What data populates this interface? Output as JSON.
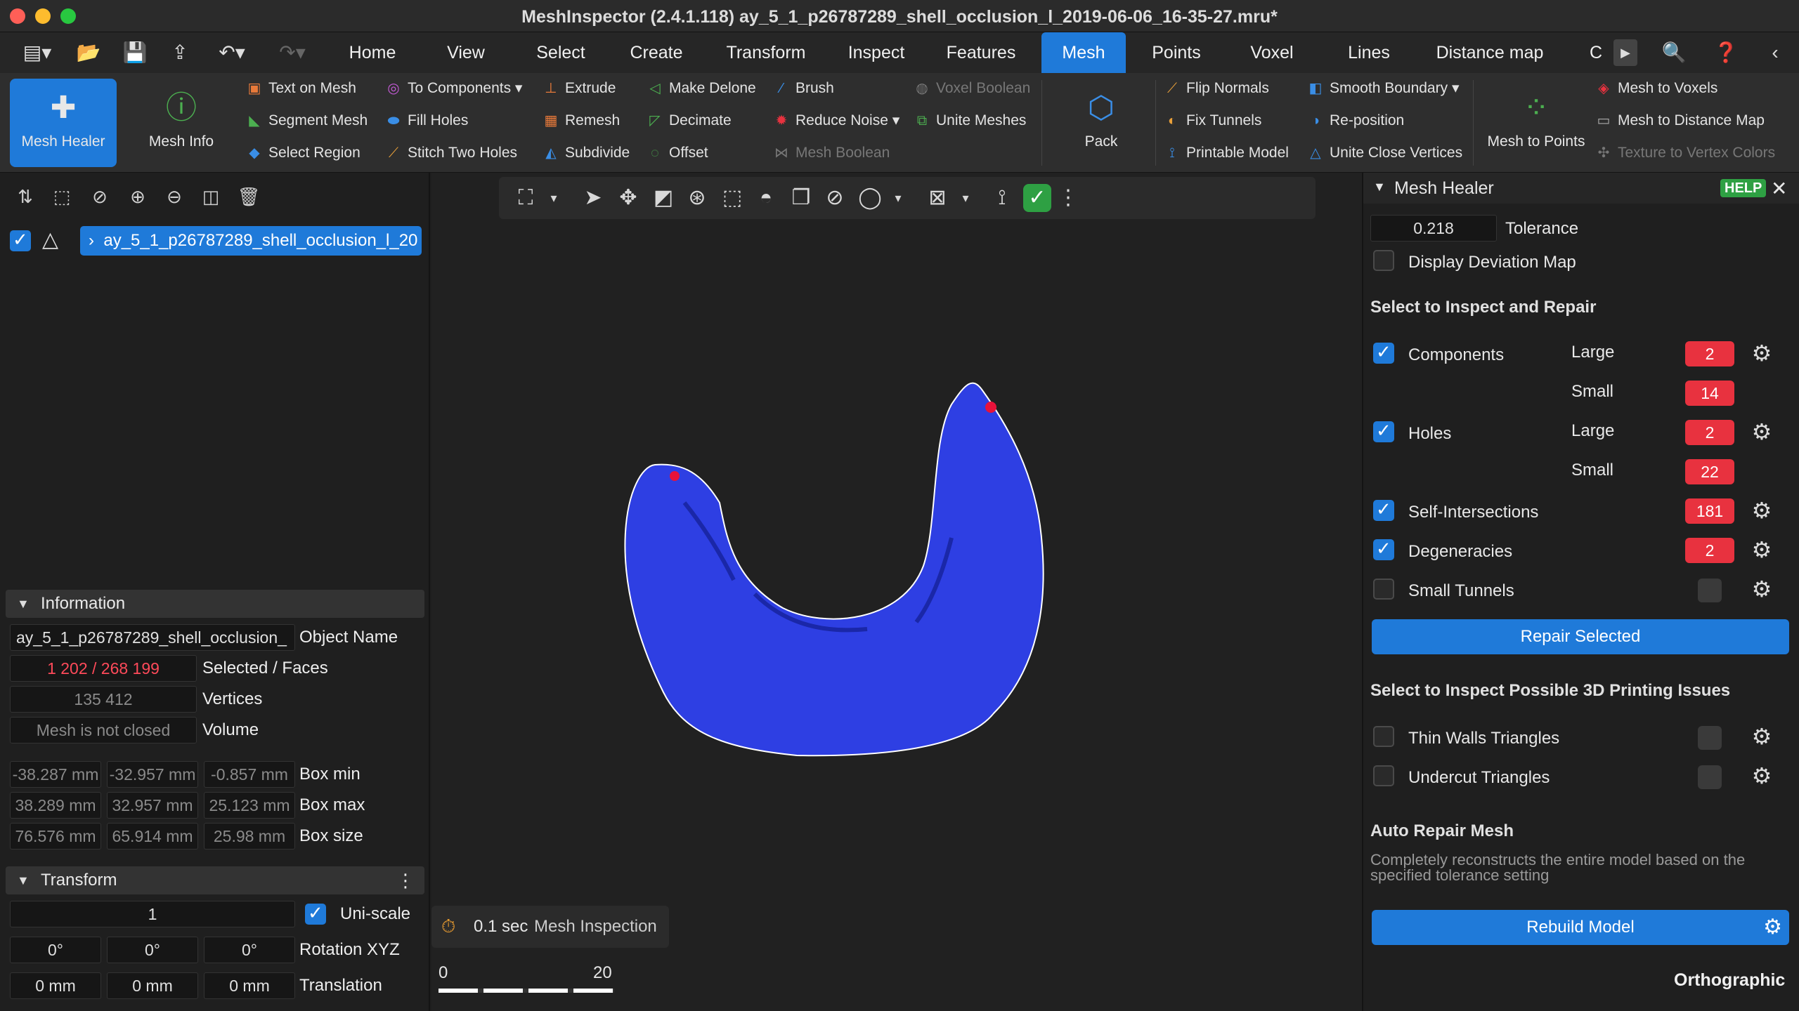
{
  "window": {
    "title": "MeshInspector (2.4.1.118) ay_5_1_p26787289_shell_occlusion_l_2019-06-06_16-35-27.mru*"
  },
  "menu": {
    "items": [
      "Home",
      "View",
      "Select",
      "Create",
      "Transform",
      "Inspect",
      "Features",
      "Mesh",
      "Points",
      "Voxel",
      "Lines",
      "Distance map",
      "C"
    ],
    "active": "Mesh"
  },
  "ribbon": {
    "mesh_healer": "Mesh Healer",
    "mesh_info": "Mesh Info",
    "text_on_mesh": "Text on Mesh",
    "segment_mesh": "Segment Mesh",
    "select_region": "Select Region",
    "to_components": "To Components",
    "fill_holes": "Fill Holes",
    "stitch_two_holes": "Stitch Two Holes",
    "extrude": "Extrude",
    "remesh": "Remesh",
    "subdivide": "Subdivide",
    "make_delone": "Make Delone",
    "decimate": "Decimate",
    "offset": "Offset",
    "brush": "Brush",
    "reduce_noise": "Reduce Noise",
    "mesh_boolean": "Mesh Boolean",
    "voxel_boolean": "Voxel Boolean",
    "unite_meshes": "Unite Meshes",
    "pack": "Pack",
    "flip_normals": "Flip Normals",
    "fix_tunnels": "Fix Tunnels",
    "printable_model": "Printable Model",
    "smooth_boundary": "Smooth Boundary",
    "reposition": "Re-position",
    "unite_close_vertices": "Unite Close Vertices",
    "mesh_to_points": "Mesh to Points",
    "mesh_to_voxels": "Mesh to Voxels",
    "mesh_to_distance_map": "Mesh to Distance Map",
    "texture_to_vertex_colors": "Texture to Vertex Colors"
  },
  "scene": {
    "object_name": "ay_5_1_p26787289_shell_occlusion_l_20"
  },
  "information": {
    "header": "Information",
    "object_name_value": "ay_5_1_p26787289_shell_occlusion_",
    "object_name_label": "Object Name",
    "selected_faces_value": "1 202 / 268 199",
    "selected_faces_label": "Selected / Faces",
    "vertices_value": "135 412",
    "vertices_label": "Vertices",
    "volume_value": "Mesh is not closed",
    "volume_label": "Volume",
    "box_min": [
      "-38.287 mm",
      "-32.957 mm",
      "-0.857 mm"
    ],
    "box_min_label": "Box min",
    "box_max": [
      "38.289 mm",
      "32.957 mm",
      "25.123 mm"
    ],
    "box_max_label": "Box max",
    "box_size": [
      "76.576 mm",
      "65.914 mm",
      "25.98 mm"
    ],
    "box_size_label": "Box size"
  },
  "transform": {
    "header": "Transform",
    "scale_value": "1",
    "uniscale_label": "Uni-scale",
    "rotation": [
      "0°",
      "0°",
      "0°"
    ],
    "rotation_label": "Rotation XYZ",
    "translation": [
      "0 mm",
      "0 mm",
      "0 mm"
    ],
    "translation_label": "Translation"
  },
  "viewport": {
    "timer_value": "0.1 sec",
    "timer_label": "Mesh Inspection",
    "scale_start": "0",
    "scale_end": "20",
    "projection": "Orthographic",
    "mesh_color": "#2f3fe0"
  },
  "healer": {
    "title": "Mesh Healer",
    "help": "HELP",
    "tolerance_value": "0.218",
    "tolerance_label": "Tolerance",
    "deviation_label": "Display Deviation Map",
    "inspect_header": "Select to Inspect and Repair",
    "components_label": "Components",
    "components_large": "2",
    "components_small": "14",
    "holes_label": "Holes",
    "holes_large": "2",
    "holes_small": "22",
    "large_label": "Large",
    "small_label": "Small",
    "self_intersections_label": "Self-Intersections",
    "self_intersections_value": "181",
    "degeneracies_label": "Degeneracies",
    "degeneracies_value": "2",
    "small_tunnels_label": "Small Tunnels",
    "repair_button": "Repair Selected",
    "printing_header": "Select to Inspect Possible 3D Printing Issues",
    "thin_walls_label": "Thin Walls Triangles",
    "undercut_label": "Undercut Triangles",
    "auto_header": "Auto Repair Mesh",
    "auto_desc": "Completely reconstructs the entire model based on the specified tolerance setting",
    "rebuild_button": "Rebuild Model"
  },
  "colors": {
    "accent": "#1f7ad9",
    "badge": "#e8323f",
    "green": "#2ea043"
  }
}
